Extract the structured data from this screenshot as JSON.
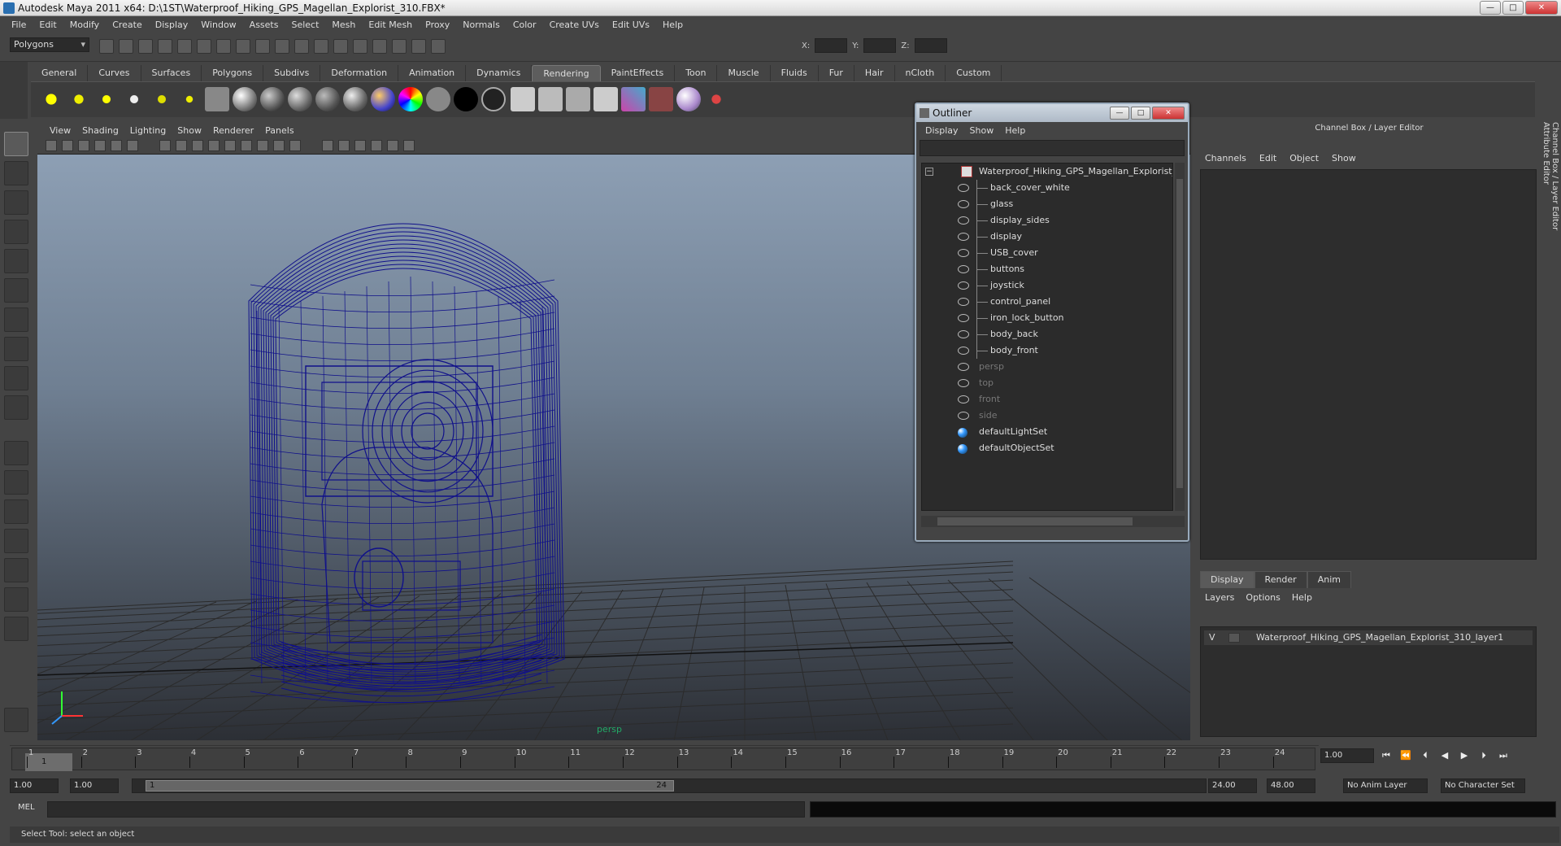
{
  "window": {
    "title": "Autodesk Maya 2011 x64: D:\\1ST\\Waterproof_Hiking_GPS_Magellan_Explorist_310.FBX*",
    "buttons": [
      "—",
      "□",
      "✕"
    ]
  },
  "menubar": [
    "File",
    "Edit",
    "Modify",
    "Create",
    "Display",
    "Window",
    "Assets",
    "Select",
    "Mesh",
    "Edit Mesh",
    "Proxy",
    "Normals",
    "Color",
    "Create UVs",
    "Edit UVs",
    "Help"
  ],
  "status_line": {
    "mode": "Polygons",
    "x_label": "X:",
    "y_label": "Y:",
    "z_label": "Z:"
  },
  "shelf": {
    "tabs": [
      "General",
      "Curves",
      "Surfaces",
      "Polygons",
      "Subdivs",
      "Deformation",
      "Animation",
      "Dynamics",
      "Rendering",
      "PaintEffects",
      "Toon",
      "Muscle",
      "Fluids",
      "Fur",
      "Hair",
      "nCloth",
      "Custom"
    ],
    "active_tab": "Rendering"
  },
  "viewport": {
    "menu": [
      "View",
      "Shading",
      "Lighting",
      "Show",
      "Renderer",
      "Panels"
    ],
    "camera": "persp",
    "wireframe_color": "#10108a"
  },
  "outliner": {
    "title": "Outliner",
    "menu": [
      "Display",
      "Show",
      "Help"
    ],
    "root": "Waterproof_Hiking_GPS_Magellan_Explorist_310",
    "children": [
      "back_cover_white",
      "glass",
      "display_sides",
      "display",
      "USB_cover",
      "buttons",
      "joystick",
      "control_panel",
      "iron_lock_button",
      "body_back",
      "body_front"
    ],
    "cameras": [
      "persp",
      "top",
      "front",
      "side"
    ],
    "sets": [
      "defaultLightSet",
      "defaultObjectSet"
    ]
  },
  "channel_box": {
    "title": "Channel Box / Layer Editor",
    "menu": [
      "Channels",
      "Edit",
      "Object",
      "Show"
    ],
    "layer_tabs": [
      "Display",
      "Render",
      "Anim"
    ],
    "active_layer_tab": "Display",
    "layer_menu": [
      "Layers",
      "Options",
      "Help"
    ],
    "layer": {
      "visible": "V",
      "name": "Waterproof_Hiking_GPS_Magellan_Explorist_310_layer1"
    },
    "side_tabs": [
      "Channel Box / Layer Editor",
      "Attribute Editor"
    ]
  },
  "time_slider": {
    "ticks": [
      "1",
      "2",
      "3",
      "4",
      "5",
      "6",
      "7",
      "8",
      "9",
      "10",
      "11",
      "12",
      "13",
      "14",
      "15",
      "16",
      "17",
      "18",
      "19",
      "20",
      "21",
      "22",
      "23",
      "24"
    ],
    "current_frame": "1",
    "current_time_field": "1.00"
  },
  "range_slider": {
    "start_time": "1.00",
    "playback_start": "1.00",
    "range_start": "1",
    "range_end": "24",
    "playback_end": "24.00",
    "end_time": "48.00",
    "anim_layer": "No Anim Layer",
    "character_set": "No Character Set"
  },
  "command_line": {
    "label": "MEL"
  },
  "help_line": "Select Tool: select an object"
}
